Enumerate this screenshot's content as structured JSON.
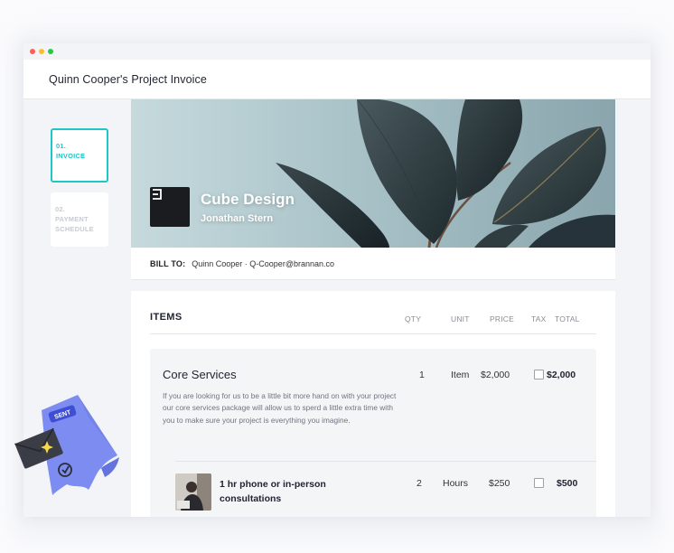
{
  "window": {
    "title": "Quinn Cooper's Project Invoice"
  },
  "steps": [
    {
      "number": "01.",
      "label": "INVOICE",
      "active": true
    },
    {
      "number": "02.",
      "label": "PAYMENT SCHEDULE",
      "active": false
    }
  ],
  "hero": {
    "company": "Cube Design",
    "contact": "Jonathan Stern",
    "logo_icon": "bracket-logo-icon"
  },
  "bill_to": {
    "label": "BILL TO:",
    "value": "Quinn Cooper · Q-Cooper@brannan.co"
  },
  "items": {
    "title": "ITEMS",
    "columns": {
      "qty": "QTY",
      "unit": "UNIT",
      "price": "PRICE",
      "tax": "TAX",
      "total": "TOTAL"
    },
    "rows": [
      {
        "name": "Core Services",
        "description": "If you are looking for us to be a little bit more hand on with your project our core services package will allow us to sperd a little extra time with you to make sure your project is everything you imagine.",
        "qty": "1",
        "unit": "Item",
        "price": "$2,000",
        "tax_checked": false,
        "total": "$2,000"
      },
      {
        "name": "1 hr phone or in-person consultations",
        "qty": "2",
        "unit": "Hours",
        "price": "$250",
        "tax_checked": false,
        "total": "$500"
      }
    ]
  },
  "sticker": {
    "badge": "SENT"
  },
  "colors": {
    "accent": "#1fc6c6",
    "sticker": "#7d8cf0"
  }
}
